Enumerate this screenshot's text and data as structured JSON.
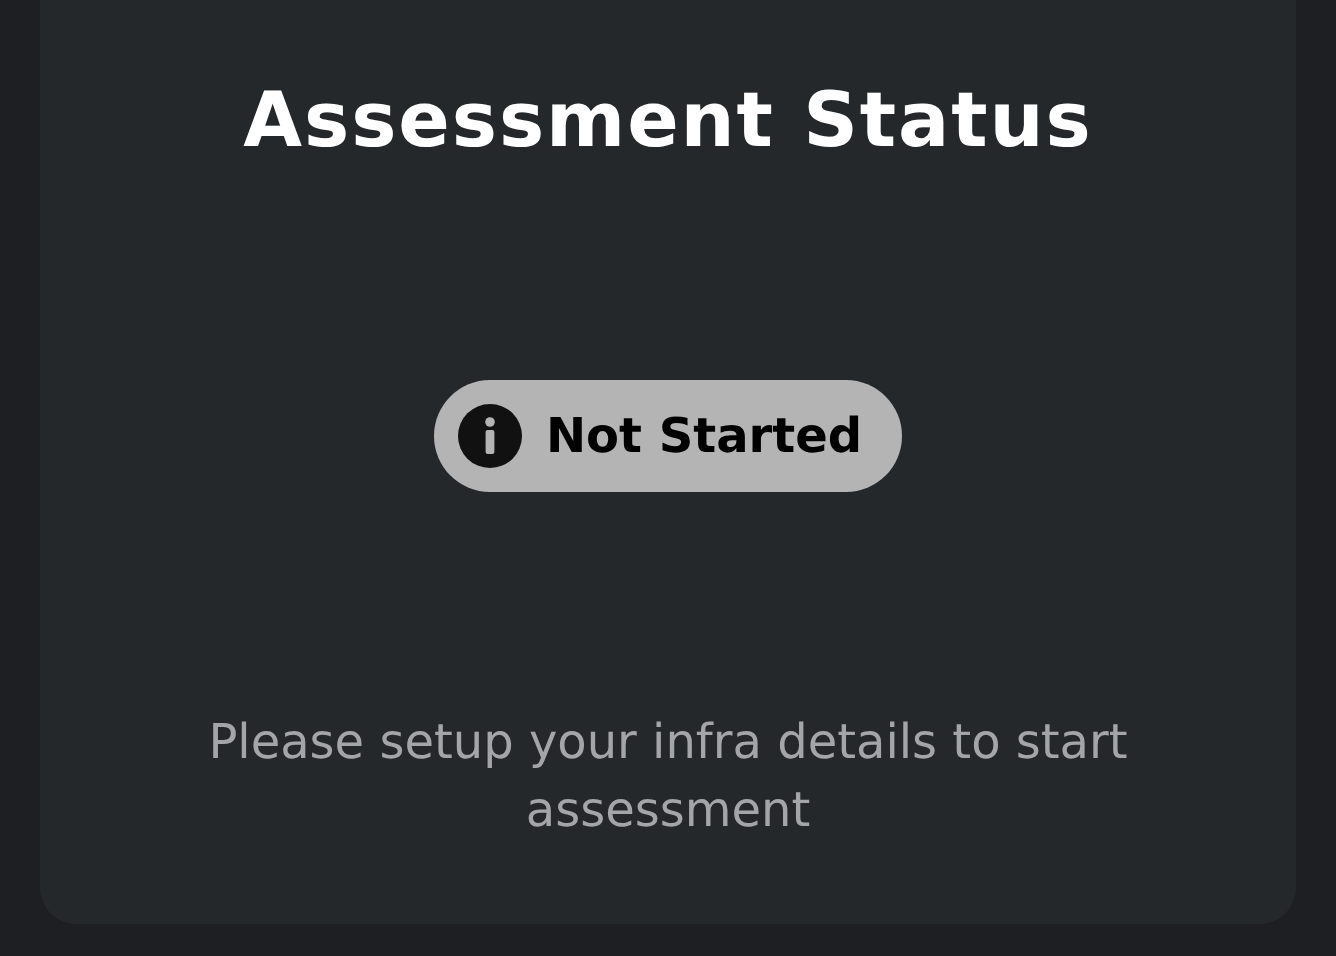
{
  "card": {
    "title": "Assessment Status",
    "status": {
      "label": "Not Started"
    },
    "message": "Please setup your infra details to start assessment"
  }
}
